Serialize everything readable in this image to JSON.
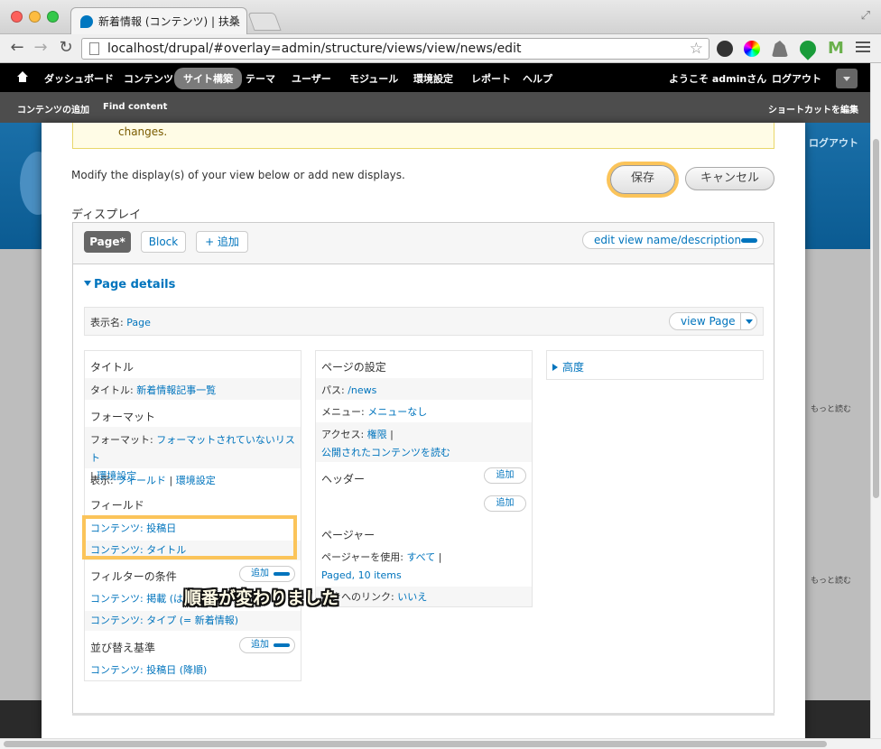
{
  "browser": {
    "tab_title": "新着情報 (コンテンツ) | 扶桑",
    "tab_close": "×",
    "url": "localhost/drupal/#overlay=admin/structure/views/view/news/edit"
  },
  "toolbar": {
    "items": [
      "ダッシュボード",
      "コンテンツ",
      "サイト構築",
      "テーマ",
      "ユーザー",
      "モジュール",
      "環境設定",
      "レポート",
      "ヘルプ"
    ],
    "active_item": "サイト構築",
    "welcome": "ようこそ adminさん",
    "logout": "ログアウト"
  },
  "shortcuts": {
    "add_content": "コンテンツの追加",
    "find_content": "Find content",
    "edit_shortcuts": "ショートカットを編集"
  },
  "background": {
    "logout": "ログアウト",
    "more": "もっと読む"
  },
  "overlay": {
    "notice_text": "changes.",
    "modify_text": "Modify the display(s) of your view below or add new displays.",
    "save": "保存",
    "cancel": "キャンセル",
    "displays_heading": "ディスプレイ",
    "tabs": {
      "page": "Page*",
      "block": "Block",
      "add": "+ 追加"
    },
    "edit_view": "edit view name/description",
    "page_details": "Page details",
    "display_name_label": "表示名:",
    "display_name_value": "Page",
    "view_page": "view Page",
    "col1": {
      "title_heading": "タイトル",
      "title_label": "タイトル:",
      "title_value": "新着情報記事一覧",
      "format_heading": "フォーマット",
      "format_label": "フォーマット:",
      "format_value": "フォーマットされていないリスト",
      "format_sep": "|",
      "format_settings": "環境設定",
      "show_label": "表示:",
      "show_value": "フィールド",
      "show_sep": "|",
      "show_settings": "環境設定",
      "fields_heading": "フィールド",
      "field_1": "コンテンツ: 投稿日",
      "field_2": "コンテンツ: タイトル",
      "filter_heading": "フィルターの条件",
      "filter_add": "追加",
      "filter_1": "コンテンツ: 掲載 (はい)",
      "filter_2": "コンテンツ: タイプ (= 新着情報)",
      "sort_heading": "並び替え基準",
      "sort_add": "追加",
      "sort_1": "コンテンツ: 投稿日 (降順)"
    },
    "col2": {
      "page_settings": "ページの設定",
      "path_label": "パス:",
      "path_value": "/news",
      "menu_label": "メニュー:",
      "menu_value": "メニューなし",
      "access_label": "アクセス:",
      "access_value": "権限",
      "access_sep": "|",
      "access_perm": "公開されたコンテンツを読む",
      "header": "ヘッダー",
      "header_add": "追加",
      "footer_add": "追加",
      "pager": "ページャー",
      "pager_label": "ページャーを使用:",
      "pager_value": "すべて",
      "pager_sep": "|",
      "pager_items": "Paged, 10 items",
      "more_label": "続きへのリンク:",
      "more_value": "いいえ"
    },
    "col3": {
      "advanced": "高度"
    },
    "annotation": "順番が変わりました"
  },
  "colors": {
    "link": "#0074bd",
    "highlight": "#fbc45a",
    "toolbar": "#000000",
    "shortcut_bar": "#4d4d4d"
  }
}
